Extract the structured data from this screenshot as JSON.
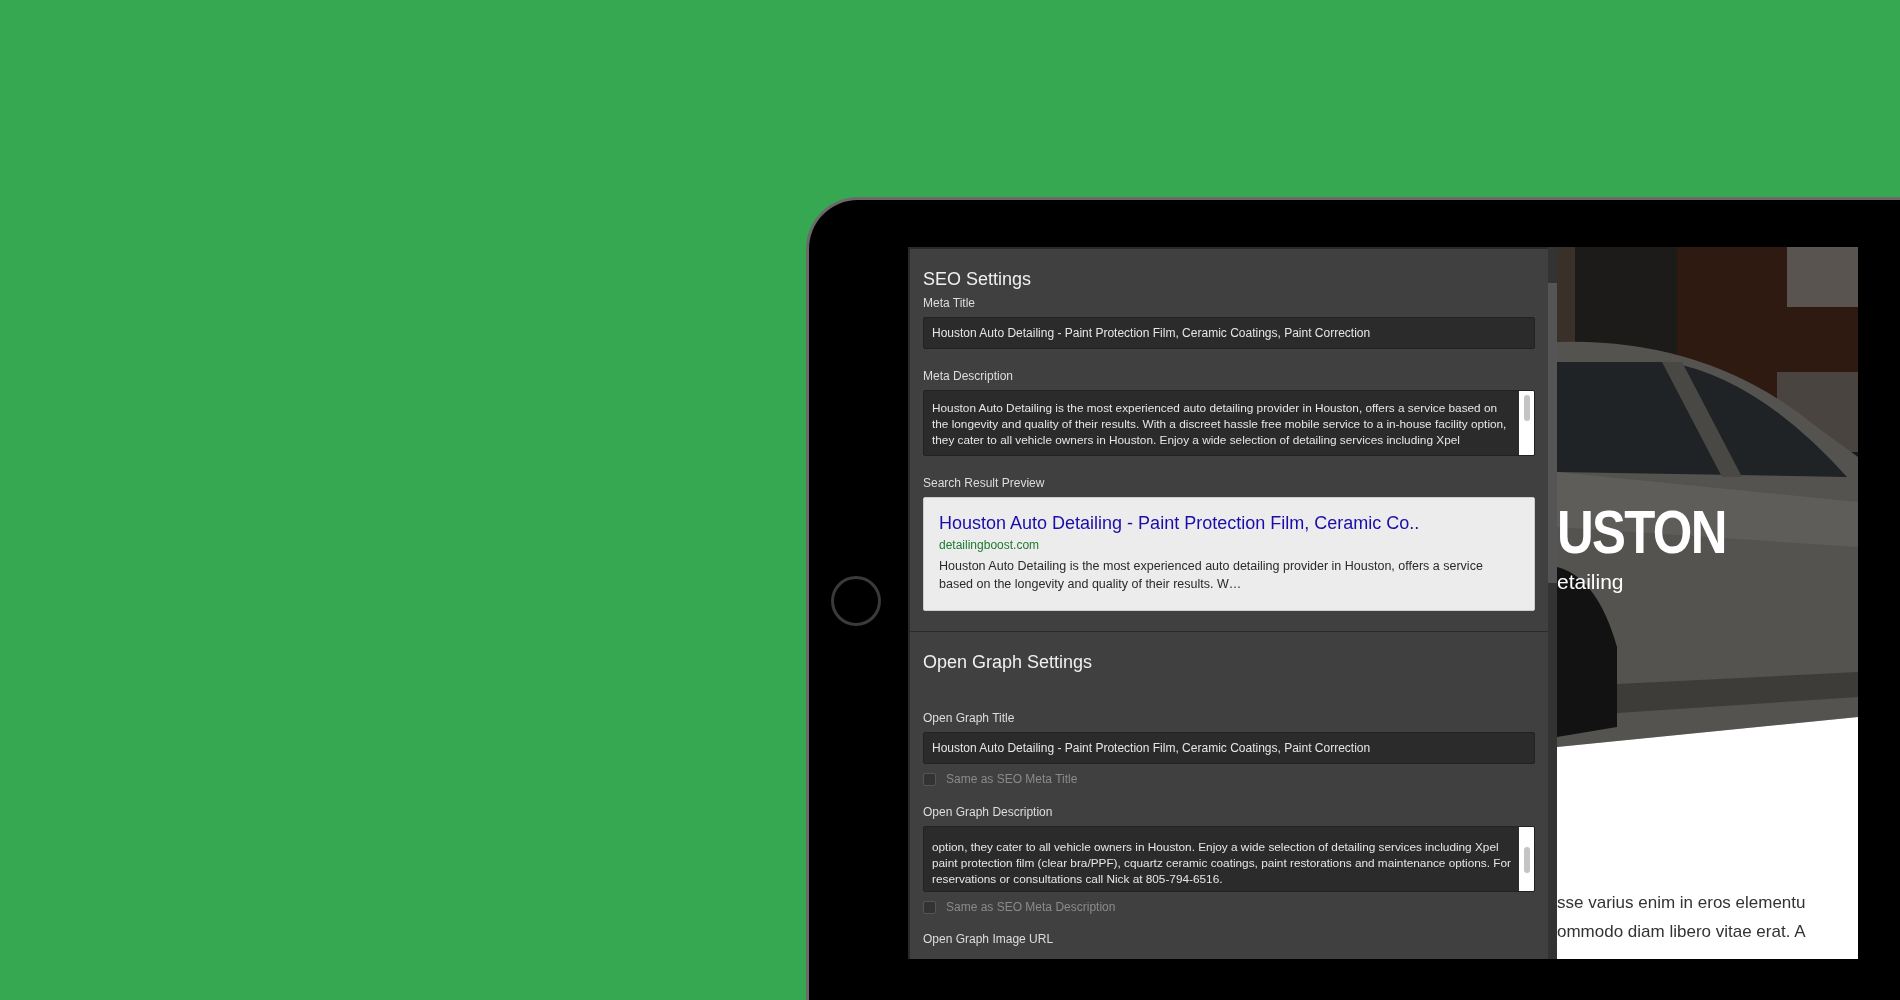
{
  "seo_settings": {
    "heading": "SEO Settings",
    "meta_title": {
      "label": "Meta Title",
      "value": "Houston Auto Detailing - Paint Protection Film, Ceramic Coatings, Paint Correction"
    },
    "meta_description": {
      "label": "Meta Description",
      "value": "Houston Auto Detailing is the most experienced auto detailing provider in Houston, offers a service based on the longevity and quality of their results. With a discreet hassle free mobile service to a in-house facility option, they cater to all vehicle owners in Houston. Enjoy a wide selection of detailing services including Xpel"
    },
    "search_result_preview": {
      "label": "Search Result Preview",
      "title": "Houston Auto Detailing - Paint Protection Film, Ceramic Co..",
      "url": "detailingboost.com",
      "description": "Houston Auto Detailing is the most experienced auto detailing provider in Houston, offers a service based on the longevity and quality of their results. W…"
    }
  },
  "open_graph_settings": {
    "heading": "Open Graph Settings",
    "title": {
      "label": "Open Graph Title",
      "value": "Houston Auto Detailing - Paint Protection Film, Ceramic Coatings, Paint Correction",
      "checkbox": {
        "label": "Same as SEO Meta Title",
        "checked": false
      }
    },
    "description": {
      "label": "Open Graph Description",
      "value": "option, they cater to all vehicle owners in Houston. Enjoy a wide selection of detailing services including Xpel paint protection film (clear bra/PPF), cquartz ceramic coatings, paint restorations and maintenance options. For reservations or consultations call Nick at 805-794-6516.",
      "checkbox": {
        "label": "Same as SEO Meta Description",
        "checked": false
      }
    },
    "image_url": {
      "label": "Open Graph Image URL"
    }
  },
  "website_preview": {
    "hero_title": "USTON",
    "hero_subtitle": "etailing",
    "body_lines": [
      "sse varius enim in eros elementu",
      "ommodo diam libero vitae erat. A"
    ]
  }
}
